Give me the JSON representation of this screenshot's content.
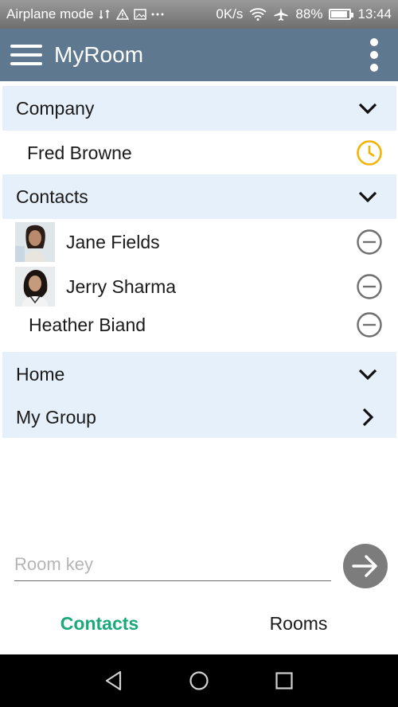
{
  "status_bar": {
    "left_text": "Airplane mode",
    "network_speed": "0K/s",
    "battery_percent": "88%",
    "battery_level": 0.88,
    "time": "13:44"
  },
  "app_bar": {
    "title": "MyRoom"
  },
  "list": {
    "company": {
      "label": "Company",
      "members": [
        {
          "name": "Fred Browne",
          "status": "clock-icon",
          "status_color": "#f2b400"
        }
      ]
    },
    "contacts": {
      "label": "Contacts",
      "members": [
        {
          "name": "Jane Fields",
          "status": "minus-circle-icon"
        },
        {
          "name": "Jerry Sharma",
          "status": "minus-circle-icon"
        },
        {
          "name": "Heather Biand",
          "status": "minus-circle-icon"
        }
      ]
    },
    "home": {
      "label": "Home"
    },
    "my_group": {
      "label": "My Group"
    }
  },
  "room_key": {
    "placeholder": "Room key",
    "value": ""
  },
  "tabs": {
    "contacts": "Contacts",
    "rooms": "Rooms"
  },
  "colors": {
    "app_bar": "#5d788f",
    "section_header": "#e6f0fb",
    "active_tab": "#1aa97a",
    "go_button": "#7c7c7c"
  }
}
